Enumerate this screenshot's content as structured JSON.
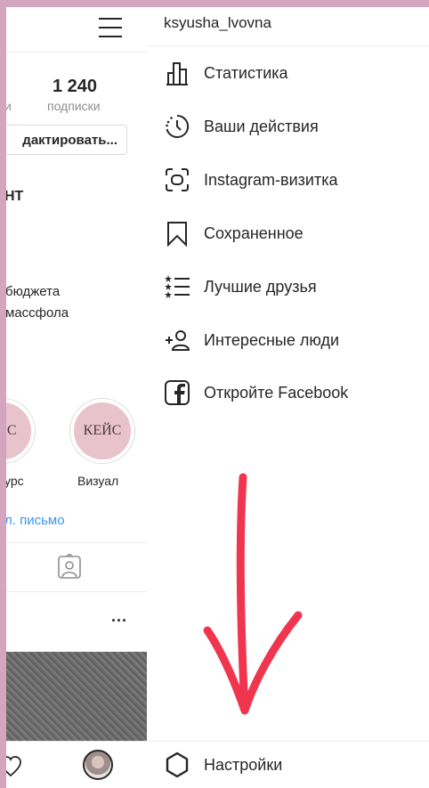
{
  "profile": {
    "following_count": "1 240",
    "following_label": "подписки",
    "followers_label_partial": "и",
    "edit_button": "дактировать...",
    "name_partial": "НТ",
    "bio_line1": "бюджета",
    "bio_line2": "массфола",
    "highlights": [
      {
        "cover": "УРС",
        "label": "урс"
      },
      {
        "cover": "КЕЙС",
        "label": "Визуал"
      }
    ],
    "email_link": "л. письмо",
    "more": "..."
  },
  "menu": {
    "username": "ksyusha_lvovna",
    "items": [
      {
        "label": "Статистика",
        "icon": "stats-icon"
      },
      {
        "label": "Ваши действия",
        "icon": "activity-icon"
      },
      {
        "label": "Instagram-визитка",
        "icon": "nametag-icon"
      },
      {
        "label": "Сохраненное",
        "icon": "bookmark-icon"
      },
      {
        "label": "Лучшие друзья",
        "icon": "close-friends-icon"
      },
      {
        "label": "Интересные люди",
        "icon": "discover-people-icon"
      },
      {
        "label": "Откройте Facebook",
        "icon": "facebook-icon"
      }
    ],
    "settings": "Настройки"
  },
  "colors": {
    "frame": "#d4a5bf",
    "arrow": "#f0364f",
    "link": "#3897f0"
  }
}
